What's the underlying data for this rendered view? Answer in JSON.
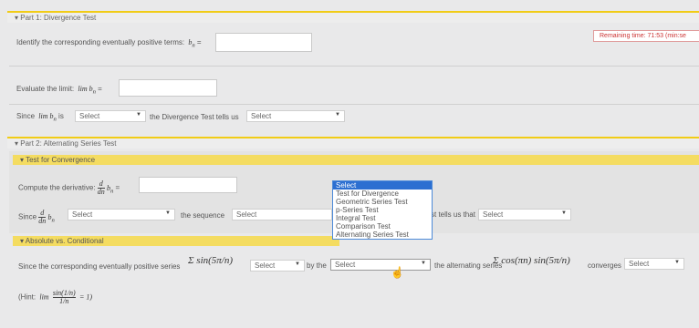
{
  "part1": {
    "title": "Part 1: Divergence Test",
    "timer": "Remaining time: 71:53 (min:se",
    "q1_text": "Identify the corresponding eventually positive terms:",
    "q2_text": "Evaluate the limit:",
    "q3_since": "Since",
    "q3_is": "is",
    "q3_select": "Select",
    "q3_mid": "the Divergence Test tells us",
    "q3_select2": "Select"
  },
  "part2": {
    "title": "Part 2: Alternating Series Test",
    "test_title": "Test for Convergence",
    "compute_text": "Compute the derivative:",
    "since": "Since",
    "select1": "Select",
    "sequence_text": "the sequence",
    "select2": "Select",
    "tells_text": "st tells us that",
    "select3": "Select",
    "dropdown_options": [
      "Select",
      "Test for Divergence",
      "Geometric Series Test",
      "p-Series Test",
      "Integral Test",
      "Comparison Test",
      "Alternating Series Test"
    ],
    "abs_title": "Absolute vs. Conditional",
    "abs_text1": "Since the corresponding eventually positive series",
    "abs_select": "Select",
    "by_the": "by the",
    "abs_select2": "Select",
    "alt_text": "the alternating series",
    "converges": "converges",
    "abs_select3": "Select",
    "hint": "(Hint:"
  }
}
